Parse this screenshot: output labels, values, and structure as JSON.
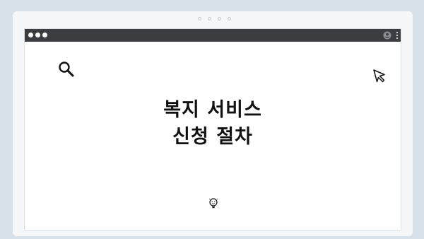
{
  "window": {
    "title_bar_color": "#3b3d40",
    "page_bg": "#ffffff"
  },
  "content": {
    "headline_line1": "복지 서비스",
    "headline_line2": "신청 절차"
  },
  "icons": {
    "search": "search-icon",
    "cursor": "cursor-pointer-icon",
    "bulb": "lightbulb-face-icon",
    "profile": "profile-icon",
    "menu": "more-vert-icon"
  }
}
